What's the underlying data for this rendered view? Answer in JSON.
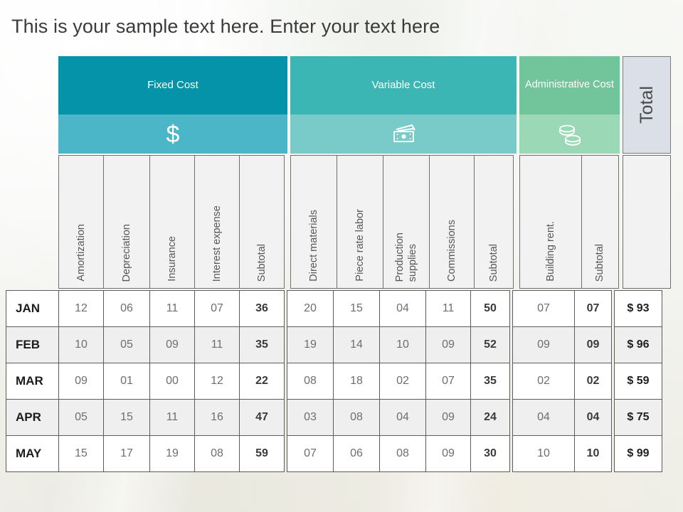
{
  "title": "This is your sample text here. Enter your text here",
  "colors": {
    "fixed_dark": "#0493a9",
    "fixed_light": "#4cb6c9",
    "variable_dark": "#3cb6b4",
    "variable_light": "#79cbc9",
    "admin_dark": "#72c49a",
    "admin_light": "#9ad8b6",
    "total_bg": "#dbdfe8",
    "subhead_bg": "#f2f2f2",
    "row_alt_bg": "#efefef"
  },
  "groups": {
    "fixed": {
      "label": "Fixed Cost",
      "icon": "dollar-sign-icon",
      "glyph": "$"
    },
    "variable": {
      "label": "Variable Cost",
      "icon": "banknotes-icon"
    },
    "admin": {
      "label": "Administrative Cost",
      "icon": "coin-stack-icon"
    },
    "total": {
      "label": "Total"
    }
  },
  "columns": {
    "fixed": [
      "Amortization",
      "Depreciation",
      "Insurance",
      "Interest expense",
      "Subtotal"
    ],
    "variable": [
      "Direct materials",
      "Piece rate labor",
      "Production\nsupplies",
      "Commissions",
      "Subtotal"
    ],
    "admin": [
      "Building rent.",
      "Subtotal"
    ],
    "total": [
      ""
    ]
  },
  "chart_data": {
    "type": "table",
    "title": "This is your sample text here. Enter your text here",
    "row_header": "",
    "group_headers": [
      "Fixed Cost",
      "Variable Cost",
      "Administrative Cost",
      "Total"
    ],
    "columns": [
      "Amortization",
      "Depreciation",
      "Insurance",
      "Interest expense",
      "Subtotal",
      "Direct materials",
      "Piece rate labor",
      "Production supplies",
      "Commissions",
      "Subtotal",
      "Building rent.",
      "Subtotal",
      "Total"
    ],
    "categories": [
      "JAN",
      "FEB",
      "MAR",
      "APR",
      "MAY"
    ],
    "rows": [
      {
        "month": "JAN",
        "fixed": [
          "12",
          "06",
          "11",
          "07"
        ],
        "fixed_subtotal": "36",
        "variable": [
          "20",
          "15",
          "04",
          "11"
        ],
        "variable_subtotal": "50",
        "admin": [
          "07"
        ],
        "admin_subtotal": "07",
        "total": "$ 93"
      },
      {
        "month": "FEB",
        "fixed": [
          "10",
          "05",
          "09",
          "11"
        ],
        "fixed_subtotal": "35",
        "variable": [
          "19",
          "14",
          "10",
          "09"
        ],
        "variable_subtotal": "52",
        "admin": [
          "09"
        ],
        "admin_subtotal": "09",
        "total": "$ 96"
      },
      {
        "month": "MAR",
        "fixed": [
          "09",
          "01",
          "00",
          "12"
        ],
        "fixed_subtotal": "22",
        "variable": [
          "08",
          "18",
          "02",
          "07"
        ],
        "variable_subtotal": "35",
        "admin": [
          "02"
        ],
        "admin_subtotal": "02",
        "total": "$ 59"
      },
      {
        "month": "APR",
        "fixed": [
          "05",
          "15",
          "11",
          "16"
        ],
        "fixed_subtotal": "47",
        "variable": [
          "03",
          "08",
          "04",
          "09"
        ],
        "variable_subtotal": "24",
        "admin": [
          "04"
        ],
        "admin_subtotal": "04",
        "total": "$ 75"
      },
      {
        "month": "MAY",
        "fixed": [
          "15",
          "17",
          "19",
          "08"
        ],
        "fixed_subtotal": "59",
        "variable": [
          "07",
          "06",
          "08",
          "09"
        ],
        "variable_subtotal": "30",
        "admin": [
          "10"
        ],
        "admin_subtotal": "10",
        "total": "$ 99"
      }
    ]
  }
}
